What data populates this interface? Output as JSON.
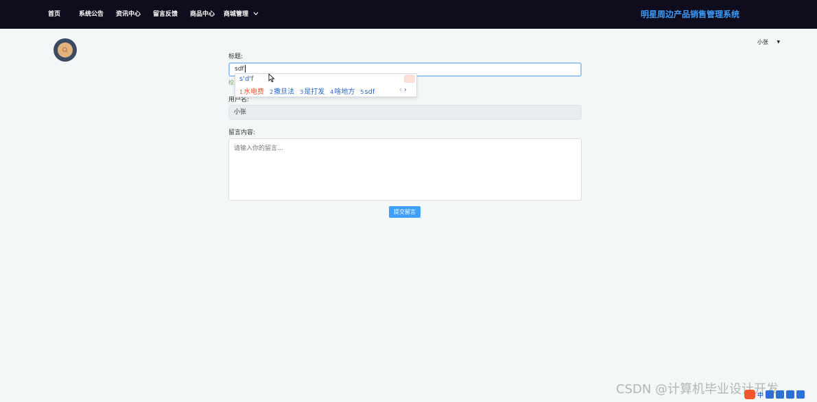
{
  "nav": {
    "items": [
      {
        "label": "首页"
      },
      {
        "label": "系统公告"
      },
      {
        "label": "资讯中心"
      },
      {
        "label": "留言反馈"
      },
      {
        "label": "商品中心"
      },
      {
        "label": "商城管理"
      }
    ],
    "site_title": "明星周边产品销售管理系统"
  },
  "user_menu": {
    "name": "小张",
    "caret": "▼"
  },
  "form": {
    "title_label": "标题:",
    "title_value": "sdf",
    "hint_fragment": "校",
    "username_label": "用户名:",
    "username_value": "小张",
    "message_label": "留言内容:",
    "message_placeholder": "请输入你的留言...",
    "submit_label": "提交留言"
  },
  "ime": {
    "composition": "s'd'f",
    "candidates": [
      {
        "num": "1",
        "text": "水电费"
      },
      {
        "num": "2",
        "text": "撒旦法"
      },
      {
        "num": "3",
        "text": "是打发"
      },
      {
        "num": "4",
        "text": "啥地方"
      },
      {
        "num": "5",
        "text": "sdf"
      }
    ],
    "prev": "‹",
    "next": "›"
  },
  "watermark": "CSDN @计算机毕业设计开发",
  "tray": {
    "lang": "中"
  },
  "colors": {
    "topbar": "#0e0c1d",
    "accent": "#409eff",
    "title": "#3f9bf5",
    "background": "#f3f7f7"
  }
}
